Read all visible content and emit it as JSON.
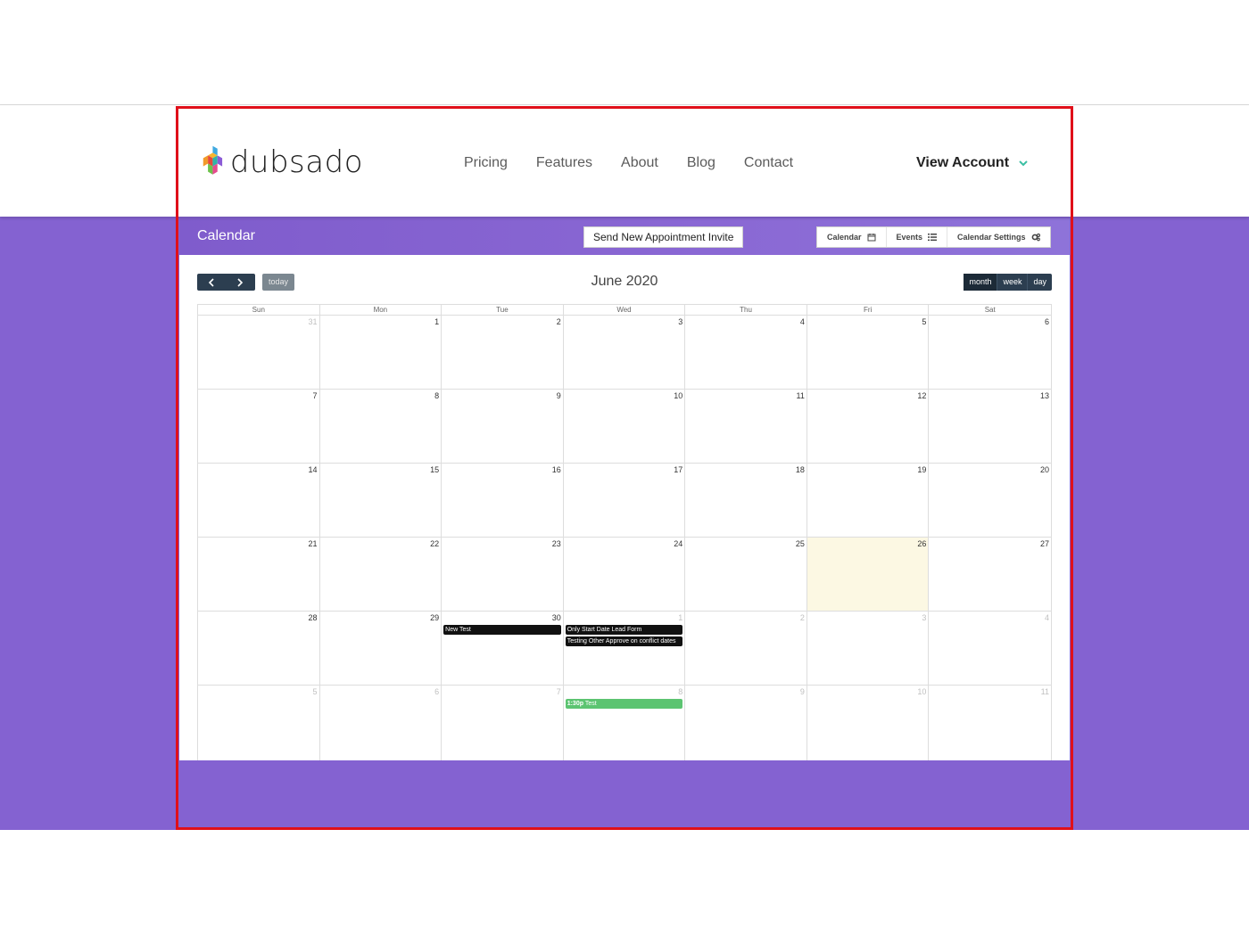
{
  "brand": {
    "name": "dubsado"
  },
  "nav": [
    "Pricing",
    "Features",
    "About",
    "Blog",
    "Contact"
  ],
  "account": {
    "label": "View Account"
  },
  "panel": {
    "title": "Calendar",
    "invite_button": "Send New Appointment Invite",
    "tabs": [
      "Calendar",
      "Events",
      "Calendar Settings"
    ]
  },
  "toolbar": {
    "today": "today",
    "month_title": "June 2020",
    "views": [
      "month",
      "week",
      "day"
    ],
    "active_view": "month"
  },
  "calendar": {
    "weekdays": [
      "Sun",
      "Mon",
      "Tue",
      "Wed",
      "Thu",
      "Fri",
      "Sat"
    ],
    "weeks": [
      [
        {
          "n": "31",
          "other": true
        },
        {
          "n": "1"
        },
        {
          "n": "2"
        },
        {
          "n": "3"
        },
        {
          "n": "4"
        },
        {
          "n": "5"
        },
        {
          "n": "6"
        }
      ],
      [
        {
          "n": "7"
        },
        {
          "n": "8"
        },
        {
          "n": "9"
        },
        {
          "n": "10"
        },
        {
          "n": "11"
        },
        {
          "n": "12"
        },
        {
          "n": "13"
        }
      ],
      [
        {
          "n": "14"
        },
        {
          "n": "15"
        },
        {
          "n": "16"
        },
        {
          "n": "17"
        },
        {
          "n": "18"
        },
        {
          "n": "19"
        },
        {
          "n": "20"
        }
      ],
      [
        {
          "n": "21"
        },
        {
          "n": "22"
        },
        {
          "n": "23"
        },
        {
          "n": "24"
        },
        {
          "n": "25"
        },
        {
          "n": "26",
          "today": true
        },
        {
          "n": "27"
        }
      ],
      [
        {
          "n": "28"
        },
        {
          "n": "29"
        },
        {
          "n": "30",
          "events": [
            {
              "title": "New Test"
            }
          ]
        },
        {
          "n": "1",
          "other": true,
          "events": [
            {
              "title": "Only Start Date Lead Form"
            },
            {
              "title": "Testing Other Approve on conflict dates"
            }
          ]
        },
        {
          "n": "2",
          "other": true
        },
        {
          "n": "3",
          "other": true
        },
        {
          "n": "4",
          "other": true
        }
      ],
      [
        {
          "n": "5",
          "other": true
        },
        {
          "n": "6",
          "other": true
        },
        {
          "n": "7",
          "other": true
        },
        {
          "n": "8",
          "other": true,
          "events": [
            {
              "time": "1:30p",
              "title": "Test",
              "color": "green"
            }
          ]
        },
        {
          "n": "9",
          "other": true
        },
        {
          "n": "10",
          "other": true
        },
        {
          "n": "11",
          "other": true
        }
      ]
    ]
  },
  "colors": {
    "brand_purple": "#8462d1",
    "toolbar_dark": "#2c3e50",
    "today_bg": "#fcf8e3",
    "event_green": "#5cc471",
    "frame_red": "#e0101a"
  }
}
